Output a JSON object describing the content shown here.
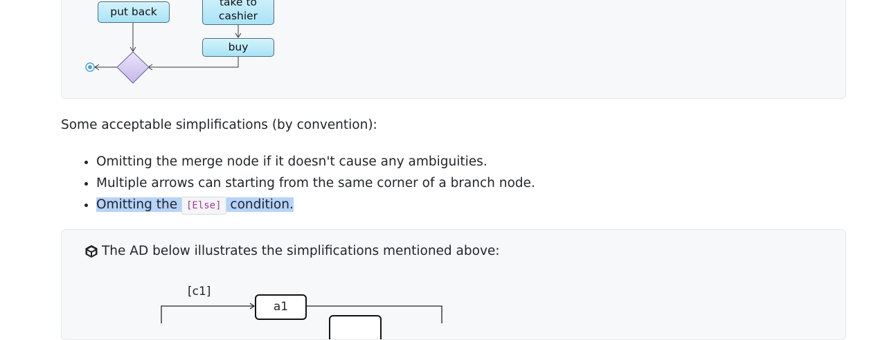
{
  "diagram1": {
    "nodes": {
      "put_back": "put back",
      "take_to_cashier_line1": "take to",
      "take_to_cashier_line2": "cashier",
      "buy": "buy"
    }
  },
  "text": {
    "intro": "Some acceptable simplifications (by convention):",
    "bullets": [
      "Omitting the merge node if it doesn't cause any ambiguities.",
      "Multiple arrows can starting from the same corner of a branch node."
    ],
    "bullet3_before": "Omitting the ",
    "bullet3_code": "[Else]",
    "bullet3_after": " condition."
  },
  "note": {
    "icon": "cube-icon",
    "text": "The AD below illustrates the simplifications mentioned above:"
  },
  "diagram2": {
    "guard": "[c1]",
    "action": "a1"
  }
}
